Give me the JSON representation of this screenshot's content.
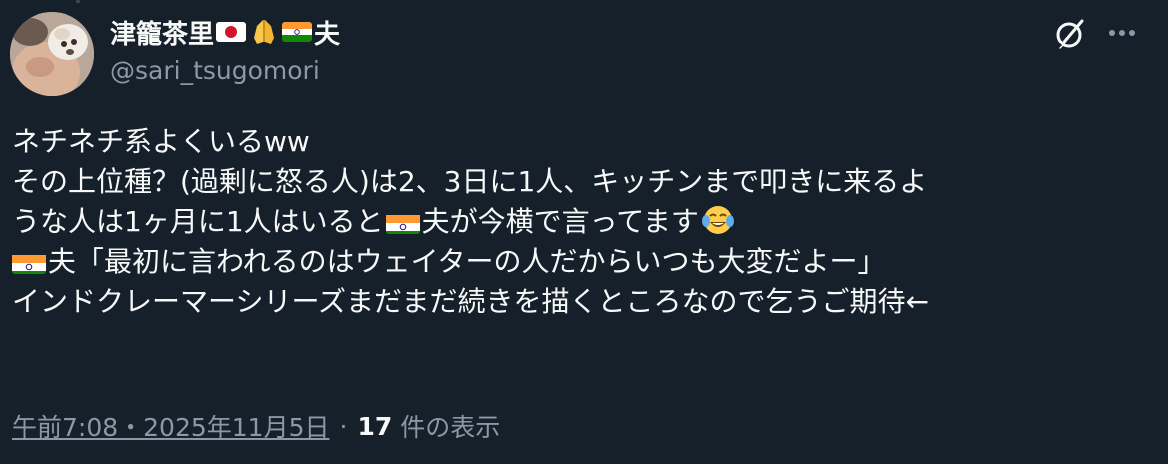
{
  "author": {
    "display_name_prefix": "津籠茶里",
    "display_name_suffix": "夫",
    "handle": "@sari_tsugomori",
    "name_emojis": [
      "japan-flag",
      "folded-hands",
      "india-flag"
    ]
  },
  "body": {
    "line1": "ネチネチ系よくいるww",
    "line2": "その上位種？(過剰に怒る人)は2、3日に1人、キッチンまで叩きに来るよ",
    "line3_a": "うな人は1ヶ月に1人はいると",
    "line3_b": "夫が今横で言ってます",
    "line4_b": "夫「最初に言われるのはウェイターの人だからいつも大変だよー」",
    "line5": "インドクレーマーシリーズまだまだ続きを描くところなので乞うご期待←"
  },
  "meta": {
    "timestamp": "午前7:08・2025年11月5日",
    "separator": "·",
    "views_count": "17",
    "views_label": "件の表示"
  },
  "icons": {
    "grok": "grok-icon",
    "more": "more-icon",
    "laugh": "tears-of-joy-emoji"
  },
  "colors": {
    "background": "#15202b",
    "text": "#f7f9f9",
    "secondary": "#8b98a5"
  }
}
